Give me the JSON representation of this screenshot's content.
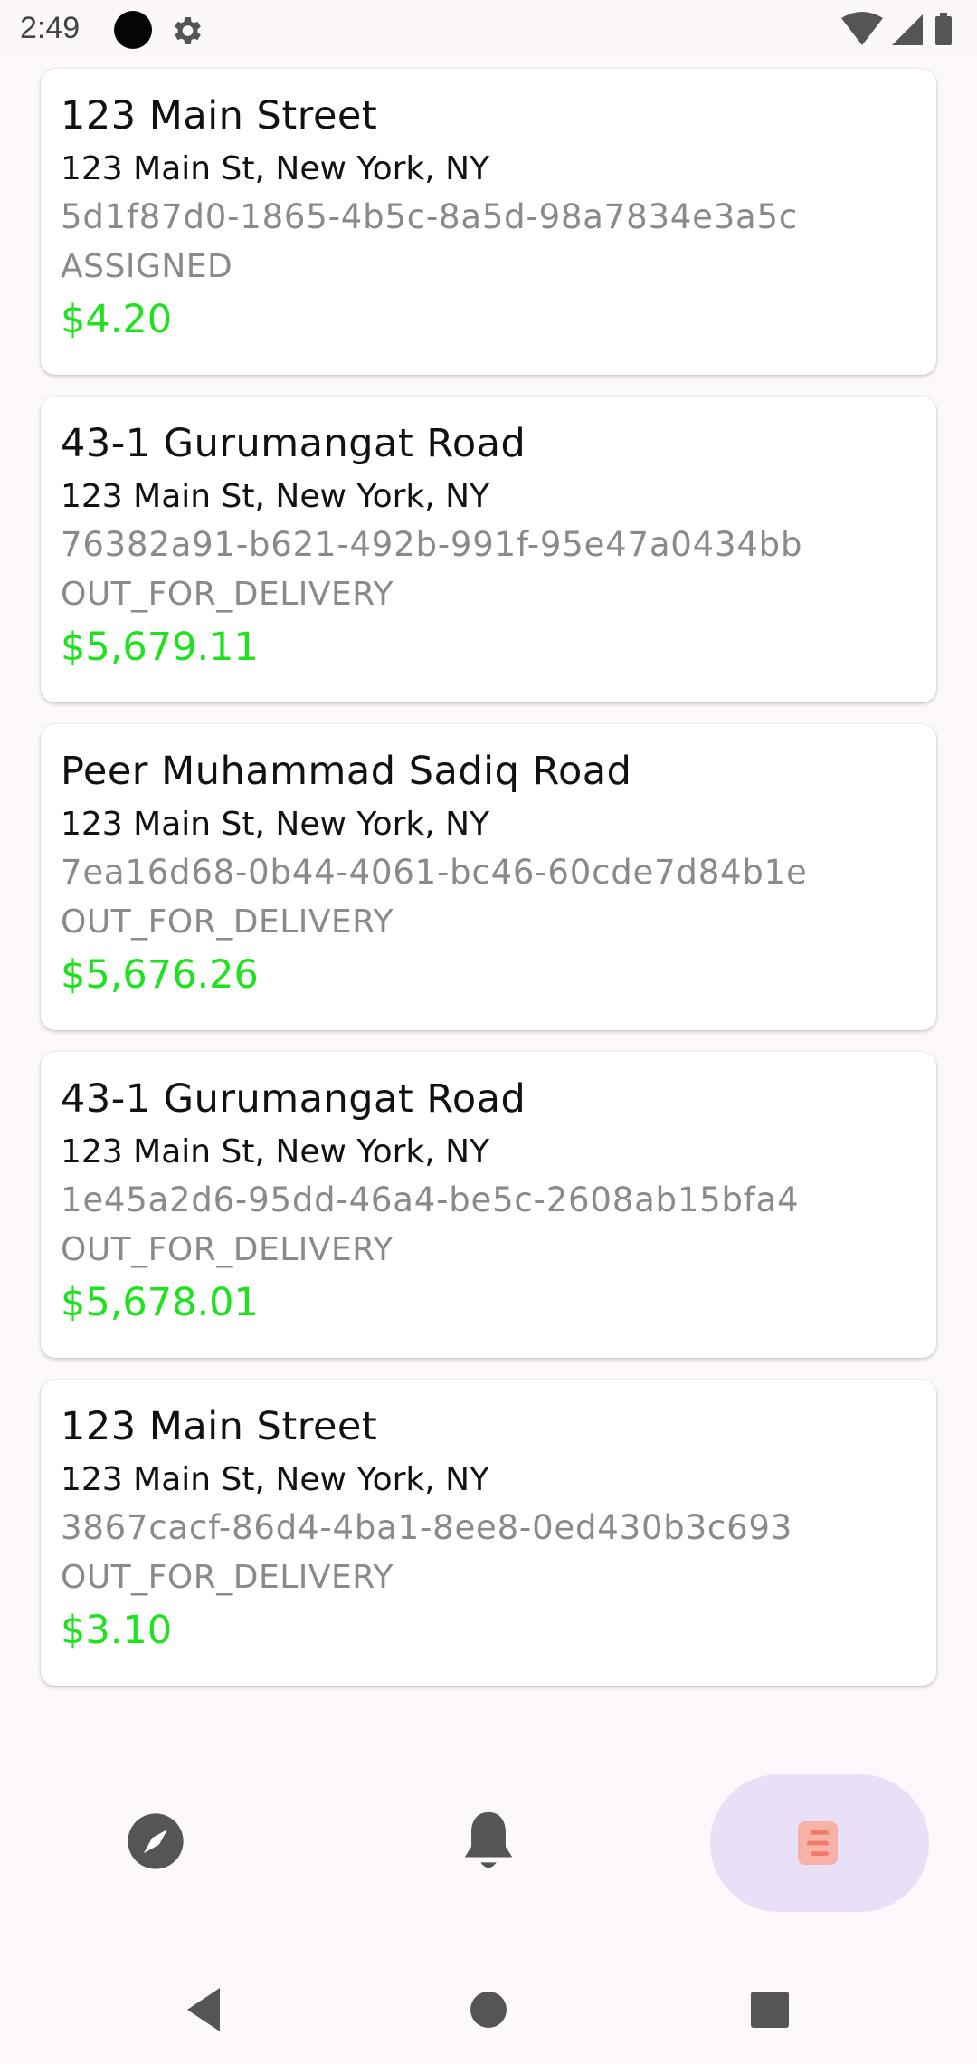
{
  "status_bar": {
    "time": "2:49",
    "icons": [
      "notification-dot-icon",
      "settings-gear-icon",
      "wifi-icon",
      "cell-signal-icon",
      "battery-icon"
    ]
  },
  "orders": [
    {
      "title": "123 Main Street",
      "address": "123 Main St, New York, NY",
      "id": "5d1f87d0-1865-4b5c-8a5d-98a7834e3a5c",
      "status": "ASSIGNED",
      "price": "$4.20"
    },
    {
      "title": "43-1 Gurumangat Road",
      "address": "123 Main St, New York, NY",
      "id": "76382a91-b621-492b-991f-95e47a0434bb",
      "status": "OUT_FOR_DELIVERY",
      "price": "$5,679.11"
    },
    {
      "title": "Peer Muhammad Sadiq Road",
      "address": "123 Main St, New York, NY",
      "id": "7ea16d68-0b44-4061-bc46-60cde7d84b1e",
      "status": "OUT_FOR_DELIVERY",
      "price": "$5,676.26"
    },
    {
      "title": "43-1 Gurumangat Road",
      "address": "123 Main St, New York, NY",
      "id": "1e45a2d6-95dd-46a4-be5c-2608ab15bfa4",
      "status": "OUT_FOR_DELIVERY",
      "price": "$5,678.01"
    },
    {
      "title": "123 Main Street",
      "address": "123 Main St, New York, NY",
      "id": "3867cacf-86d4-4ba1-8ee8-0ed430b3c693",
      "status": "OUT_FOR_DELIVERY",
      "price": "$3.10"
    }
  ],
  "bottom_nav": {
    "items": [
      {
        "icon": "compass-icon",
        "selected": false
      },
      {
        "icon": "bell-icon",
        "selected": false
      },
      {
        "icon": "orders-list-icon",
        "selected": true
      }
    ]
  },
  "colors": {
    "price": "#1ee21e",
    "selected_pill": "#e8e0f6",
    "selected_icon": "#f28a7c",
    "nav_icon": "#555555"
  },
  "system_nav": [
    "back-icon",
    "home-icon",
    "recents-icon"
  ]
}
